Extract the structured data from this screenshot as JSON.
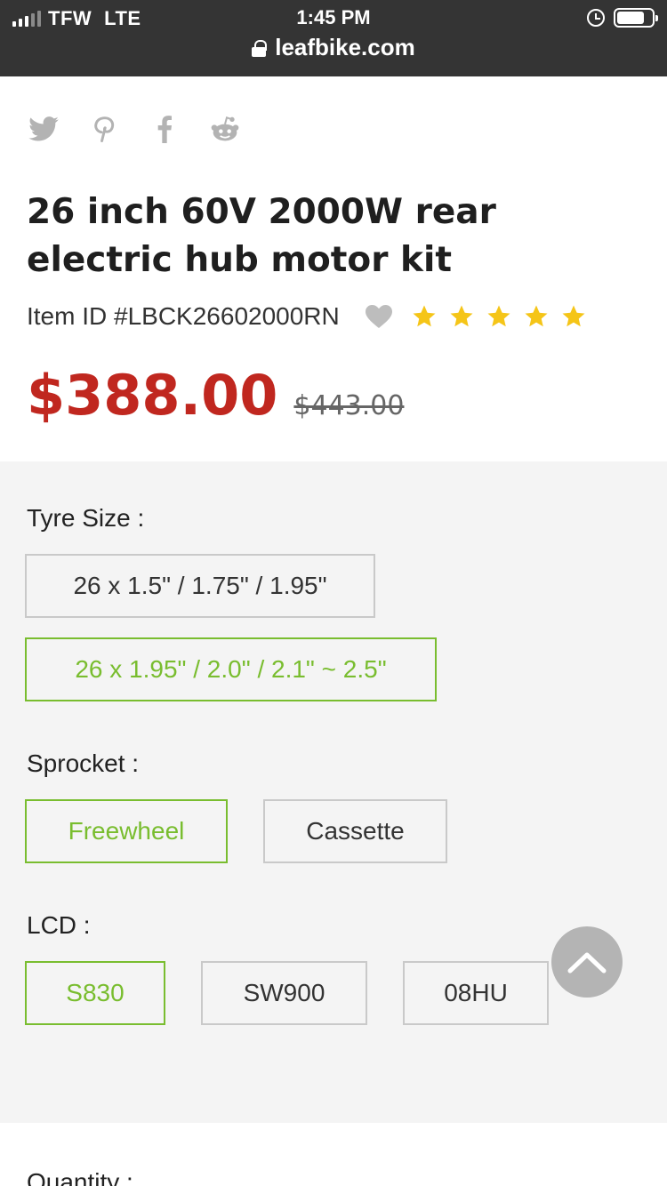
{
  "status_bar": {
    "carrier": "TFW",
    "network": "LTE",
    "time": "1:45 PM",
    "url": "leafbike.com"
  },
  "social_icons": [
    "twitter-icon",
    "pinterest-icon",
    "facebook-icon",
    "reddit-icon"
  ],
  "product": {
    "title": "26 inch 60V 2000W rear electric hub motor kit",
    "item_id": "Item ID #LBCK26602000RN",
    "rating": 5,
    "price": "$388.00",
    "old_price": "$443.00"
  },
  "options": {
    "tyre_size": {
      "label": "Tyre Size :",
      "choices": [
        "26 x 1.5\" / 1.75\" / 1.95\"",
        "26 x 1.95\" / 2.0\" / 2.1\" ~ 2.5\""
      ],
      "selected": 1
    },
    "sprocket": {
      "label": "Sprocket :",
      "choices": [
        "Freewheel",
        "Cassette"
      ],
      "selected": 0
    },
    "lcd": {
      "label": "LCD :",
      "choices": [
        "S830",
        "SW900",
        "08HU"
      ],
      "selected": 0
    }
  },
  "quantity_label": "Quantity :",
  "colors": {
    "accent_green": "#79bd2f",
    "price_red": "#c0271f",
    "star_yellow": "#f5c518"
  }
}
